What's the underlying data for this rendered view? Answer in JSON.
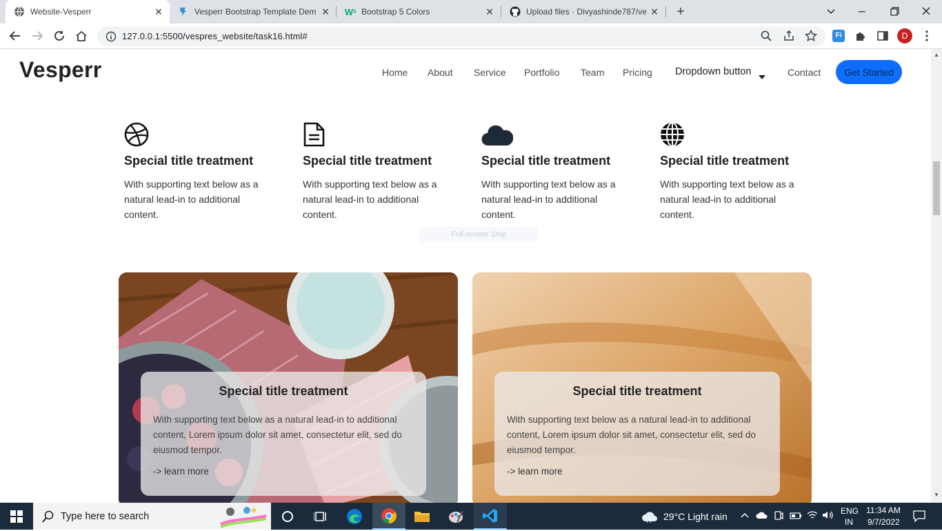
{
  "browser": {
    "tabs": [
      {
        "title": "Website-Vesperr",
        "active": true
      },
      {
        "title": "Vesperr Bootstrap Template Dem",
        "active": false
      },
      {
        "title": "Bootstrap 5 Colors",
        "active": false
      },
      {
        "title": "Upload files · Divyashinde787/ve",
        "active": false
      }
    ],
    "new_tab": "+",
    "url": "127.0.0.1:5500/vespres_website/task16.html#",
    "profile_initial": "D",
    "extension_label": "Fi"
  },
  "site": {
    "brand": "Vesperr",
    "nav": [
      "Home",
      "About",
      "Service",
      "Portfolio",
      "Team",
      "Pricing",
      "Dropdown button",
      "Contact"
    ],
    "cta": "Get Started",
    "accent_color": "#0d6efd",
    "services": [
      {
        "icon": "dribbble-icon",
        "title": "Special title treatment",
        "text": "With supporting text below as a natural lead-in to additional content."
      },
      {
        "icon": "file-text-icon",
        "title": "Special title treatment",
        "text": "With supporting text below as a natural lead-in to additional content."
      },
      {
        "icon": "cloud-icon",
        "title": "Special title treatment",
        "text": "With supporting text below as a natural lead-in to additional content."
      },
      {
        "icon": "globe-icon",
        "title": "Special title treatment",
        "text": "With supporting text below as a natural lead-in to additional content."
      }
    ],
    "snip_hint": "Full-screen Snip",
    "cards": [
      {
        "title": "Special title treatment",
        "text": "With supporting text below as a natural lead-in to additional content, Lorem ipsum dolor sit amet, consectetur elit, sed do eiusmod tempor.",
        "link": "-> learn more"
      },
      {
        "title": "Special title treatment",
        "text": "With supporting text below as a natural lead-in to additional content, Lorem ipsum dolor sit amet, consectetur elit, sed do eiusmod tempor.",
        "link": "-> learn more"
      }
    ]
  },
  "taskbar": {
    "search_placeholder": "Type here to search",
    "weather": "29°C  Light rain",
    "lang1": "ENG",
    "lang2": "IN",
    "time": "11:34 AM",
    "date": "9/7/2022"
  }
}
